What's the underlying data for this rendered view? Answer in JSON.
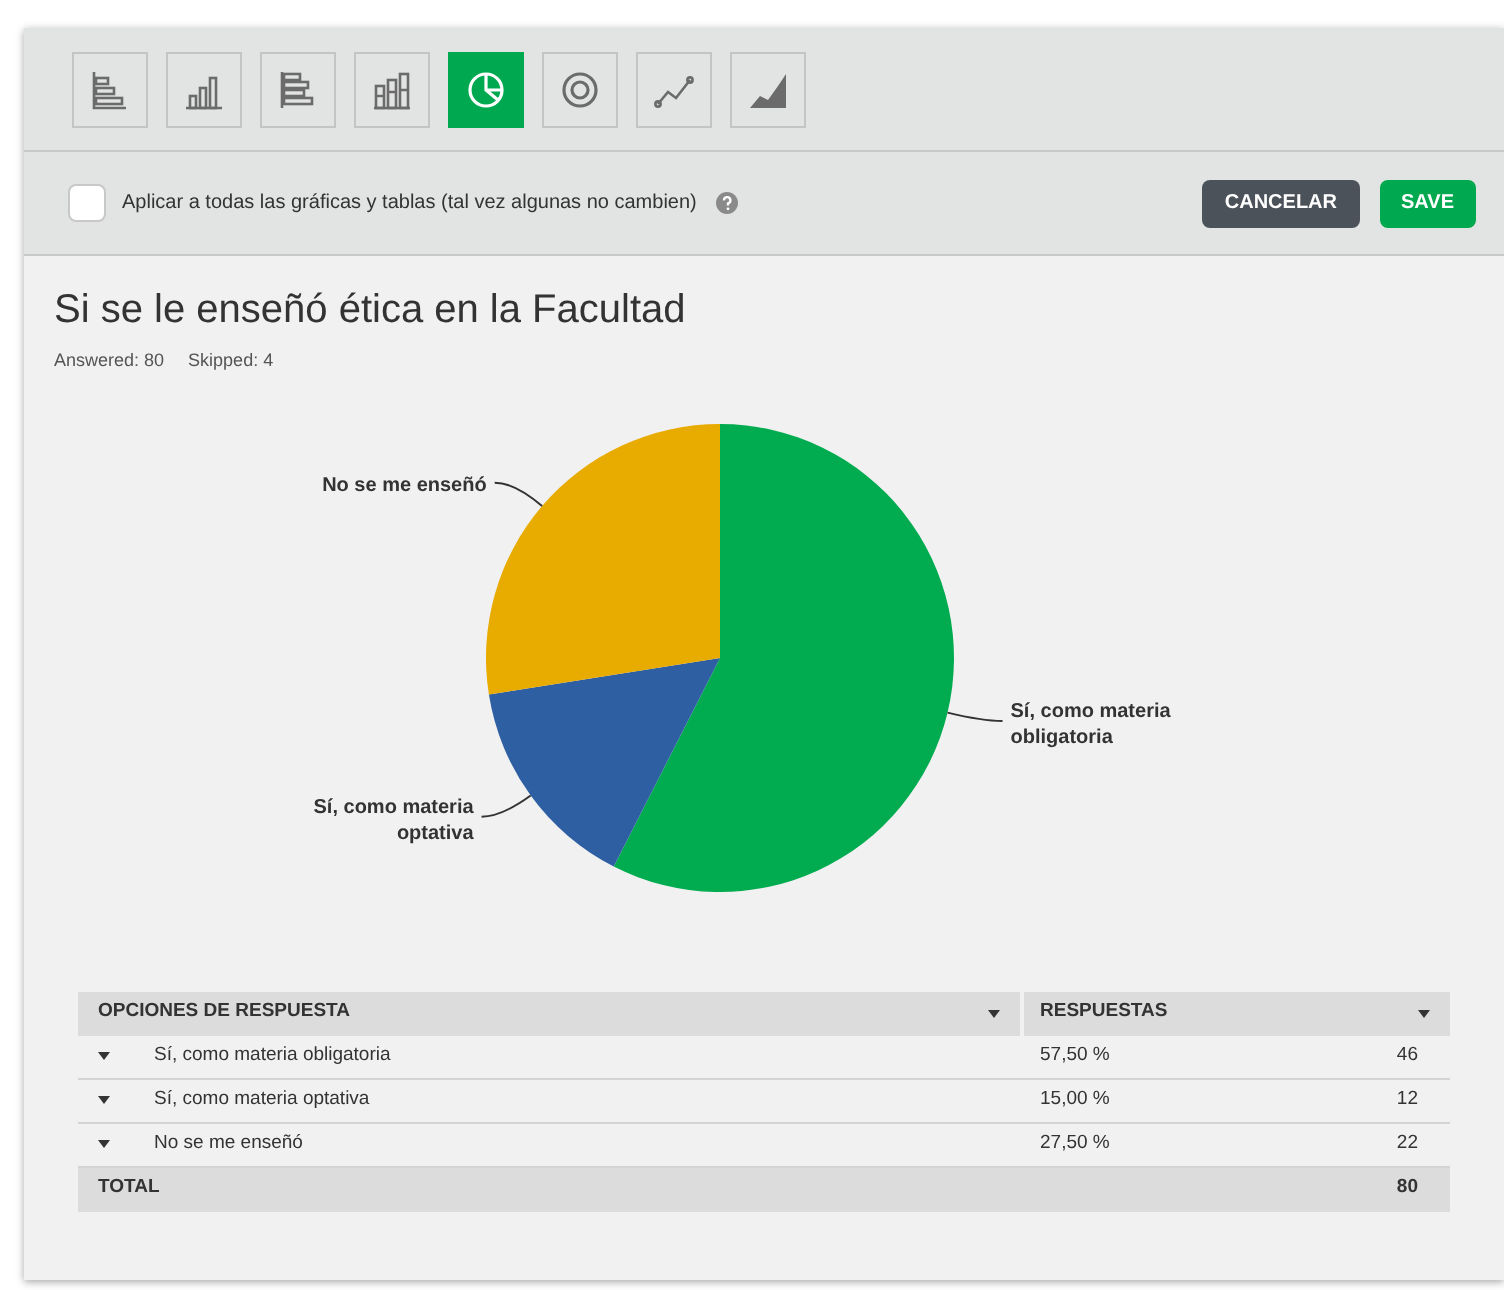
{
  "chart_types": [
    {
      "kind": "hbar",
      "selected": false
    },
    {
      "kind": "vbar",
      "selected": false
    },
    {
      "kind": "hstack",
      "selected": false
    },
    {
      "kind": "vstack",
      "selected": false
    },
    {
      "kind": "pie",
      "selected": true
    },
    {
      "kind": "donut",
      "selected": false
    },
    {
      "kind": "line",
      "selected": false
    },
    {
      "kind": "area",
      "selected": false
    }
  ],
  "apply_all": {
    "label": "Aplicar a todas las gráficas y tablas (tal vez algunas no cambien)",
    "checked": false
  },
  "buttons": {
    "cancel": "CANCELAR",
    "save": "SAVE"
  },
  "question": {
    "title": "Si se le enseñó ética en la Facultad",
    "answered": "Answered: 80",
    "skipped": "Skipped: 4"
  },
  "chart_data": {
    "type": "pie",
    "categories": [
      "Sí, como materia obligatoria",
      "Sí, como materia optativa",
      "No se me enseñó"
    ],
    "values": [
      57.5,
      15,
      27.5
    ],
    "colors": [
      "#00ac4f",
      "#2e5fa3",
      "#e8ab00"
    ]
  },
  "table": {
    "columns": [
      "OPCIONES DE RESPUESTA",
      "RESPUESTAS"
    ],
    "rows": [
      {
        "option": "Sí, como materia obligatoria",
        "percent": "57,50 %",
        "count": "46"
      },
      {
        "option": "Sí, como materia optativa",
        "percent": "15,00 %",
        "count": "12"
      },
      {
        "option": "No se me enseñó",
        "percent": "27,50 %",
        "count": "22"
      }
    ],
    "total": {
      "label": "TOTAL",
      "count": "80"
    }
  }
}
